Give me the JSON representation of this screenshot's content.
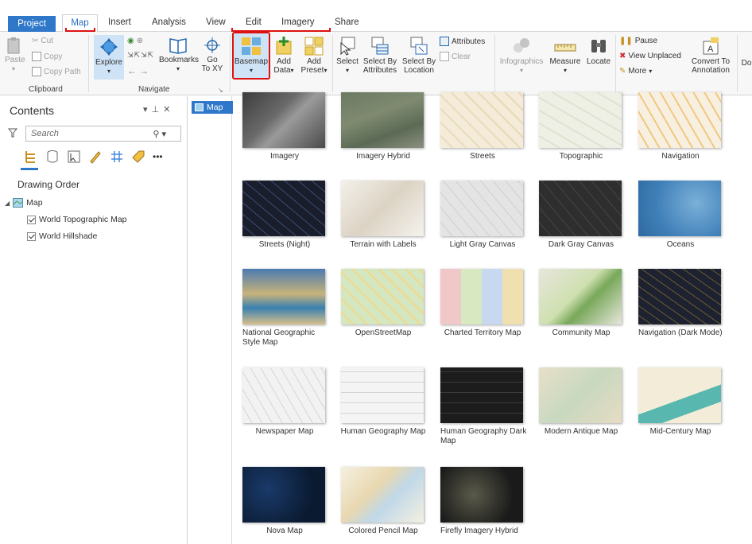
{
  "tabs": [
    "Project",
    "Map",
    "Insert",
    "Analysis",
    "View",
    "Edit",
    "Imagery",
    "Share"
  ],
  "ribbon": {
    "clipboard": {
      "paste": "Paste",
      "cut": "Cut",
      "copy": "Copy",
      "copy_path": "Copy Path",
      "label": "Clipboard"
    },
    "navigate": {
      "explore": "Explore",
      "bookmarks": "Bookmarks",
      "go_to_xy_1": "Go",
      "go_to_xy_2": "To XY",
      "label": "Navigate"
    },
    "layer": {
      "basemap": "Basemap",
      "add_data_1": "Add",
      "add_data_2": "Data",
      "add_preset_1": "Add",
      "add_preset_2": "Preset"
    },
    "selection": {
      "select": "Select",
      "select_by_attr_1": "Select By",
      "select_by_attr_2": "Attributes",
      "select_by_loc_1": "Select By",
      "select_by_loc_2": "Location",
      "attributes": "Attributes",
      "clear": "Clear"
    },
    "inquiry": {
      "infographics": "Infographics",
      "measure": "Measure",
      "locate": "Locate"
    },
    "labeling": {
      "pause": "Pause",
      "view_unplaced": "View Unplaced",
      "more": "More",
      "convert_1": "Convert To",
      "convert_2": "Annotation",
      "do": "Do"
    }
  },
  "contents": {
    "title": "Contents",
    "search_placeholder": "Search",
    "drawing_order": "Drawing Order",
    "map_node": "Map",
    "layers": [
      "World Topographic Map",
      "World Hillshade"
    ]
  },
  "map_tab": "Map",
  "basemaps": [
    "Imagery",
    "Imagery Hybrid",
    "Streets",
    "Topographic",
    "Navigation",
    "Streets (Night)",
    "Terrain with Labels",
    "Light Gray Canvas",
    "Dark Gray Canvas",
    "Oceans",
    "National Geographic Style Map",
    "OpenStreetMap",
    "Charted Territory Map",
    "Community Map",
    "Navigation (Dark Mode)",
    "Newspaper Map",
    "Human Geography Map",
    "Human Geography Dark Map",
    "Modern Antique Map",
    "Mid-Century Map",
    "Nova Map",
    "Colored Pencil Map",
    "Firefly Imagery Hybrid"
  ],
  "colors": {
    "accent": "#2f78c9",
    "highlight": "#d11111"
  }
}
